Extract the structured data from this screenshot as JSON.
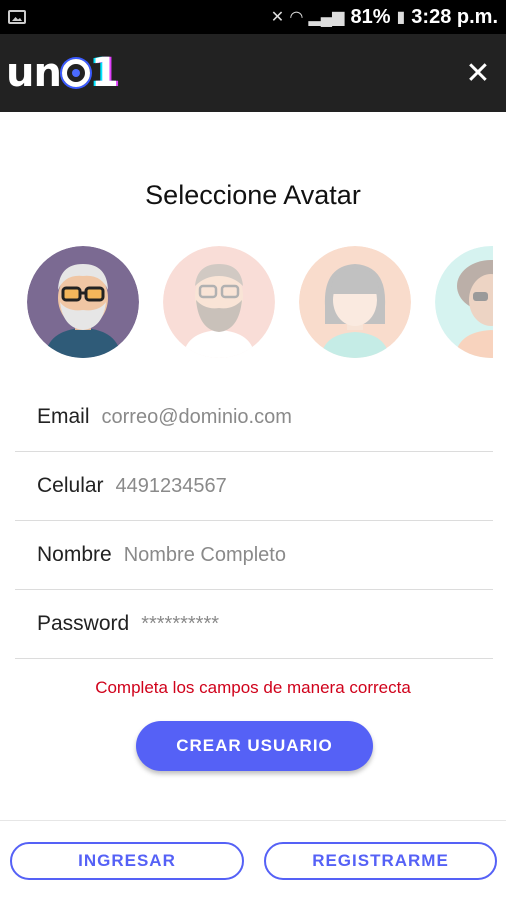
{
  "status_bar": {
    "battery": "81%",
    "time": "3:28 p.m."
  },
  "app_bar": {
    "logo_text": "uno",
    "logo_number": "1",
    "close_icon": "close-icon"
  },
  "title": "Seleccione Avatar",
  "avatars": [
    {
      "name": "older-man-glasses",
      "bg": "#7b6a92",
      "selected": true
    },
    {
      "name": "bearded-man",
      "bg": "#f3b6a8",
      "selected": false
    },
    {
      "name": "woman-bangs",
      "bg": "#f3b28f",
      "selected": false
    },
    {
      "name": "curly-hair-sunglasses",
      "bg": "#a6e6e0",
      "selected": false
    }
  ],
  "form": {
    "email": {
      "label": "Email",
      "placeholder": "correo@dominio.com"
    },
    "phone": {
      "label": "Celular",
      "placeholder": "4491234567"
    },
    "name": {
      "label": "Nombre",
      "placeholder": "Nombre Completo"
    },
    "password": {
      "label": "Password",
      "placeholder": "**********"
    }
  },
  "error_message": "Completa los campos de manera correcta",
  "create_button": "CREAR USUARIO",
  "footer": {
    "login_button": "INGRESAR",
    "register_button": "REGISTRARME"
  },
  "colors": {
    "accent": "#5561f6",
    "error": "#d0021b",
    "appbar": "#222222"
  }
}
